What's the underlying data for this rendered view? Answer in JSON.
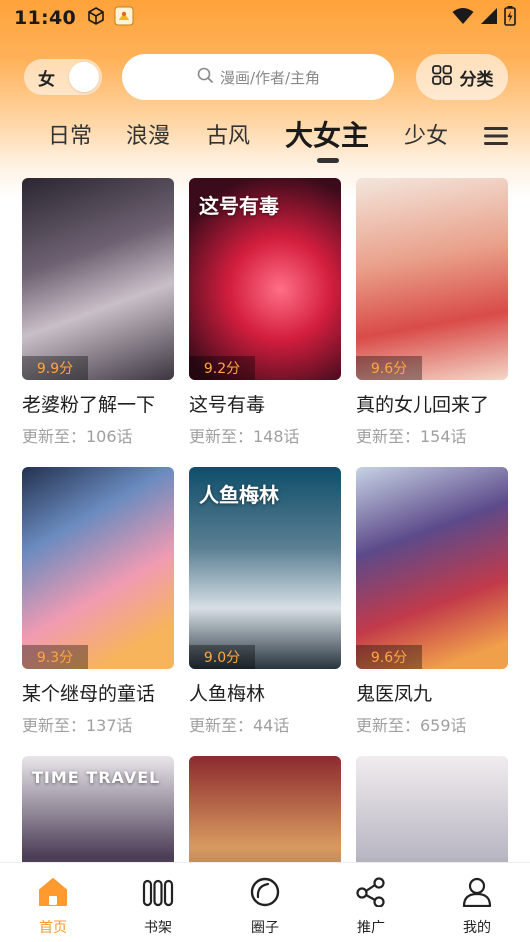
{
  "status_bar": {
    "time": "11:40"
  },
  "header": {
    "gender_label": "女",
    "search_placeholder": "漫画/作者/主角",
    "category_label": "分类"
  },
  "tabs": [
    {
      "label": "日常"
    },
    {
      "label": "浪漫"
    },
    {
      "label": "古风"
    },
    {
      "label": "大女主",
      "active": true
    },
    {
      "label": "少女"
    }
  ],
  "comics": [
    {
      "title": "老婆粉了解一下",
      "score": "9.9分",
      "update": "更新至：106话"
    },
    {
      "title": "这号有毒",
      "score": "9.2分",
      "update": "更新至：148话",
      "cover_text": "这号有毒"
    },
    {
      "title": "真的女儿回来了",
      "score": "9.6分",
      "update": "更新至：154话"
    },
    {
      "title": "某个继母的童话",
      "score": "9.3分",
      "update": "更新至：137话"
    },
    {
      "title": "人鱼梅林",
      "score": "9.0分",
      "update": "更新至：44话",
      "cover_text": "人鱼梅林"
    },
    {
      "title": "鬼医凤九",
      "score": "9.6分",
      "update": "更新至：659话"
    },
    {
      "title": "",
      "score": "",
      "update": "",
      "cover_text": "TIME TRAVEL"
    },
    {
      "title": "",
      "score": "",
      "update": ""
    },
    {
      "title": "",
      "score": "",
      "update": ""
    }
  ],
  "bottom_nav": [
    {
      "label": "首页",
      "icon": "home-icon",
      "active": true
    },
    {
      "label": "书架",
      "icon": "bookshelf-icon"
    },
    {
      "label": "圈子",
      "icon": "circle-icon"
    },
    {
      "label": "推广",
      "icon": "share-icon"
    },
    {
      "label": "我的",
      "icon": "profile-icon"
    }
  ],
  "colors": {
    "accent": "#ff9a2e",
    "score": "#ffa640"
  }
}
